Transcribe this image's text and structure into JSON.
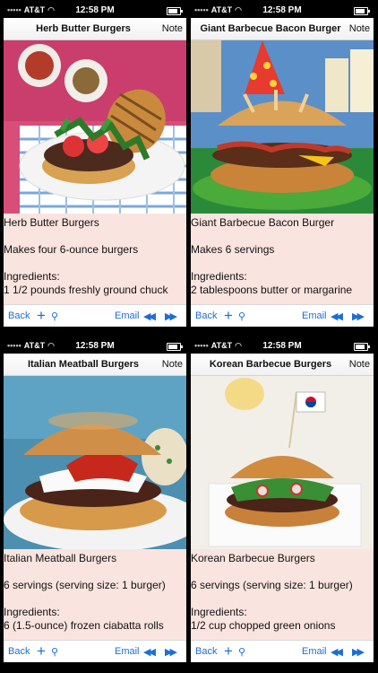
{
  "status_bar": {
    "signal": "•••••",
    "carrier": "AT&T",
    "time": "12:58 PM"
  },
  "nav": {
    "note_label": "Note"
  },
  "toolbar": {
    "back_label": "Back",
    "email_label": "Email"
  },
  "recipes": [
    {
      "nav_title": "Herb Butter Burgers",
      "name": "Herb Butter Burgers",
      "yield": "Makes four 6-ounce burgers",
      "ingredients_label": "Ingredients:",
      "first_ingredient": "1 1/2 pounds freshly ground chuck"
    },
    {
      "nav_title": "Giant Barbecue Bacon Burger",
      "name": "Giant Barbecue Bacon Burger",
      "yield": "Makes 6 servings",
      "ingredients_label": "Ingredients:",
      "first_ingredient": "2 tablespoons butter or margarine"
    },
    {
      "nav_title": "Italian Meatball Burgers",
      "name": "Italian Meatball Burgers",
      "yield": "6 servings (serving size: 1 burger)",
      "ingredients_label": "Ingredients:",
      "first_ingredient": "6 (1.5-ounce) frozen ciabatta rolls"
    },
    {
      "nav_title": "Korean Barbecue Burgers",
      "name": "Korean Barbecue Burgers",
      "yield": "6 servings (serving size: 1 burger)",
      "ingredients_label": "Ingredients:",
      "first_ingredient": "1/2 cup chopped green onions"
    }
  ],
  "colors": {
    "accent": "#1b6ed8",
    "content_bg": "#fae4df"
  }
}
